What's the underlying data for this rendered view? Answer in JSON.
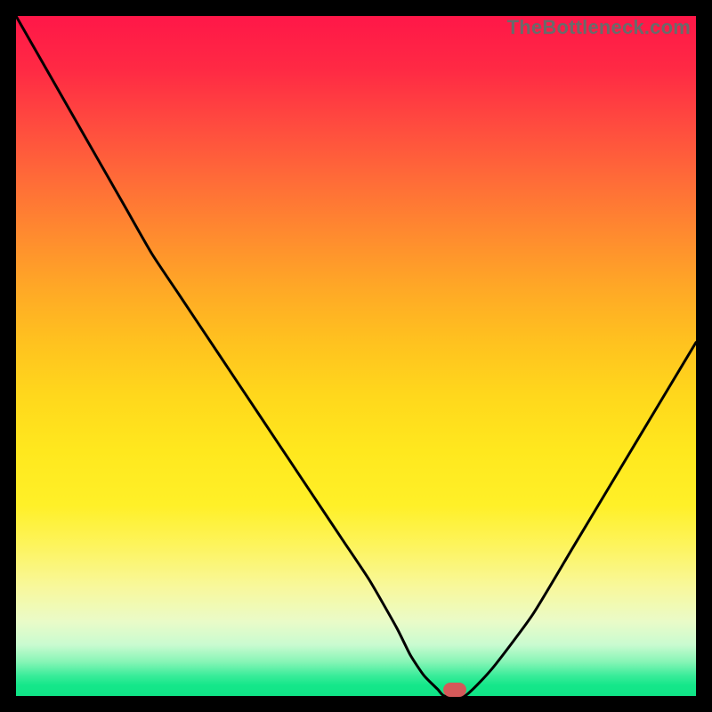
{
  "watermark": "TheBottleneck.com",
  "chart_data": {
    "type": "line",
    "title": "",
    "xlabel": "",
    "ylabel": "",
    "xlim": [
      0,
      100
    ],
    "ylim": [
      0,
      100
    ],
    "grid": false,
    "legend": false,
    "gradient_stops": [
      {
        "pct": 0,
        "color": "#ff1748"
      },
      {
        "pct": 8,
        "color": "#ff2a44"
      },
      {
        "pct": 16,
        "color": "#ff4b3f"
      },
      {
        "pct": 24,
        "color": "#ff6b38"
      },
      {
        "pct": 32,
        "color": "#ff8a2f"
      },
      {
        "pct": 40,
        "color": "#ffa826"
      },
      {
        "pct": 48,
        "color": "#ffc21f"
      },
      {
        "pct": 56,
        "color": "#ffd81c"
      },
      {
        "pct": 64,
        "color": "#ffe81e"
      },
      {
        "pct": 72,
        "color": "#fff028"
      },
      {
        "pct": 78,
        "color": "#fdf45e"
      },
      {
        "pct": 84,
        "color": "#f8f89c"
      },
      {
        "pct": 89,
        "color": "#eafbc8"
      },
      {
        "pct": 92.5,
        "color": "#c9fbd0"
      },
      {
        "pct": 95,
        "color": "#86f5b6"
      },
      {
        "pct": 97,
        "color": "#3aec9a"
      },
      {
        "pct": 98.4,
        "color": "#15e78a"
      },
      {
        "pct": 100,
        "color": "#0fe486"
      }
    ],
    "series": [
      {
        "name": "bottleneck-curve",
        "x": [
          0,
          4,
          8,
          12,
          16,
          20,
          24,
          28,
          32,
          36,
          40,
          44,
          48,
          52,
          56,
          58,
          60,
          62,
          63,
          66,
          70,
          76,
          82,
          88,
          94,
          100
        ],
        "y": [
          100,
          93,
          86,
          79,
          72,
          65,
          59,
          53,
          47,
          41,
          35,
          29,
          23,
          17,
          10,
          6,
          3,
          1,
          0,
          0,
          4,
          12,
          22,
          32,
          42,
          52
        ]
      }
    ],
    "marker": {
      "x": 64.5,
      "y": 0.9,
      "color": "#d45959"
    },
    "curve_color": "#000000",
    "curve_stroke_width": 3
  }
}
